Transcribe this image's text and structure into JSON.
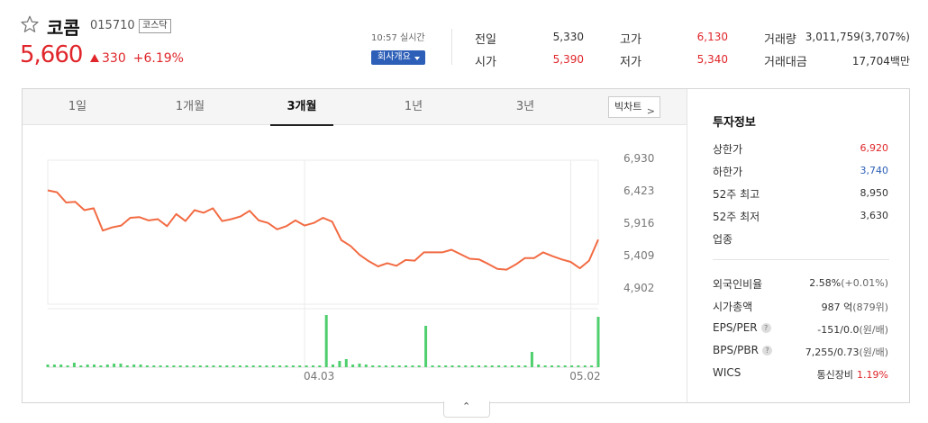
{
  "stock": {
    "name": "코콤",
    "code": "015710",
    "market_badge": "코스닥",
    "price": "5,660",
    "change": "330",
    "change_pct": "+6.19%",
    "realtime": "10:57 실시간",
    "company_button": "회사개요"
  },
  "quote": [
    {
      "label": "전일",
      "value": "5,330",
      "color": "nt"
    },
    {
      "label": "시가",
      "value": "5,390",
      "color": "up"
    },
    {
      "label": "고가",
      "value": "6,130",
      "color": "up"
    },
    {
      "label": "저가",
      "value": "5,340",
      "color": "up"
    },
    {
      "label": "거래량",
      "value": "3,011,759(3,707%)",
      "color": "nt"
    },
    {
      "label": "거래대금",
      "value": "17,704백만",
      "color": "nt"
    }
  ],
  "tabs": [
    "1일",
    "1개월",
    "3개월",
    "1년",
    "3년"
  ],
  "active_tab": "3개월",
  "big_chart_label": "빅차트",
  "invest": {
    "title": "투자정보",
    "rows1": [
      {
        "label": "상한가",
        "value": "6,920",
        "sub": "",
        "color": "up"
      },
      {
        "label": "하한가",
        "value": "3,740",
        "sub": "",
        "color": "dn"
      },
      {
        "label": "52주 최고",
        "value": "8,950",
        "sub": "",
        "color": "nt"
      },
      {
        "label": "52주 최저",
        "value": "3,630",
        "sub": "",
        "color": "nt"
      },
      {
        "label": "업종",
        "value": "",
        "sub": "",
        "color": "nt"
      }
    ],
    "rows2": [
      {
        "label": "외국인비율",
        "value": "2.58%",
        "sub": "(+0.01%)",
        "color": "nt"
      },
      {
        "label": "시가총액",
        "value": "987 억",
        "sub": "(879위)",
        "color": "nt"
      },
      {
        "label": "EPS/PER",
        "value": "-151/0.0",
        "sub": "(원/배)",
        "color": "nt",
        "help": "?"
      },
      {
        "label": "BPS/PBR",
        "value": "7,255/0.73",
        "sub": "(원/배)",
        "color": "nt",
        "help": "?"
      },
      {
        "label": "WICS",
        "value": "통신장비",
        "sub": "1.19%",
        "color": "nt",
        "subcolor": "up"
      }
    ]
  },
  "colors": {
    "up": "#e0262b",
    "down": "#2d5fb8",
    "line": "#f26b43",
    "volume": "#4fcf6e"
  },
  "chart_data": {
    "type": "line",
    "yticks": [
      "6,930",
      "6,423",
      "5,916",
      "5,409",
      "4,902"
    ],
    "ytick_values": [
      6930,
      6423,
      5916,
      5409,
      4902
    ],
    "xticks": [
      {
        "label": "04.03",
        "index": 28
      },
      {
        "label": "05.02",
        "index": 57
      }
    ],
    "price_series": [
      6430,
      6400,
      6240,
      6250,
      6120,
      6150,
      5800,
      5850,
      5880,
      6000,
      6010,
      5960,
      5980,
      5870,
      6060,
      5950,
      6120,
      6080,
      6150,
      5950,
      5980,
      6020,
      6110,
      5960,
      5920,
      5820,
      5870,
      5960,
      5880,
      5920,
      6000,
      5940,
      5650,
      5560,
      5420,
      5320,
      5240,
      5290,
      5250,
      5340,
      5330,
      5460,
      5460,
      5460,
      5500,
      5430,
      5360,
      5350,
      5280,
      5200,
      5190,
      5270,
      5370,
      5370,
      5460,
      5400,
      5350,
      5310,
      5210,
      5330,
      5660
    ],
    "volume_series": [
      30,
      30,
      30,
      20,
      50,
      20,
      30,
      30,
      20,
      30,
      40,
      40,
      20,
      30,
      30,
      20,
      20,
      20,
      20,
      20,
      20,
      20,
      20,
      20,
      20,
      20,
      20,
      20,
      20,
      20,
      20,
      20,
      20,
      20,
      20,
      20,
      20,
      20,
      20,
      20,
      20,
      20,
      580,
      30,
      70,
      90,
      30,
      40,
      30,
      20,
      20,
      20,
      20,
      20,
      20,
      20,
      20,
      460,
      20,
      20,
      20,
      20,
      20,
      20,
      20,
      20,
      20,
      20,
      20,
      20,
      20,
      20,
      20,
      170,
      30,
      20,
      20,
      20,
      20,
      20,
      20,
      20,
      20,
      560
    ]
  }
}
